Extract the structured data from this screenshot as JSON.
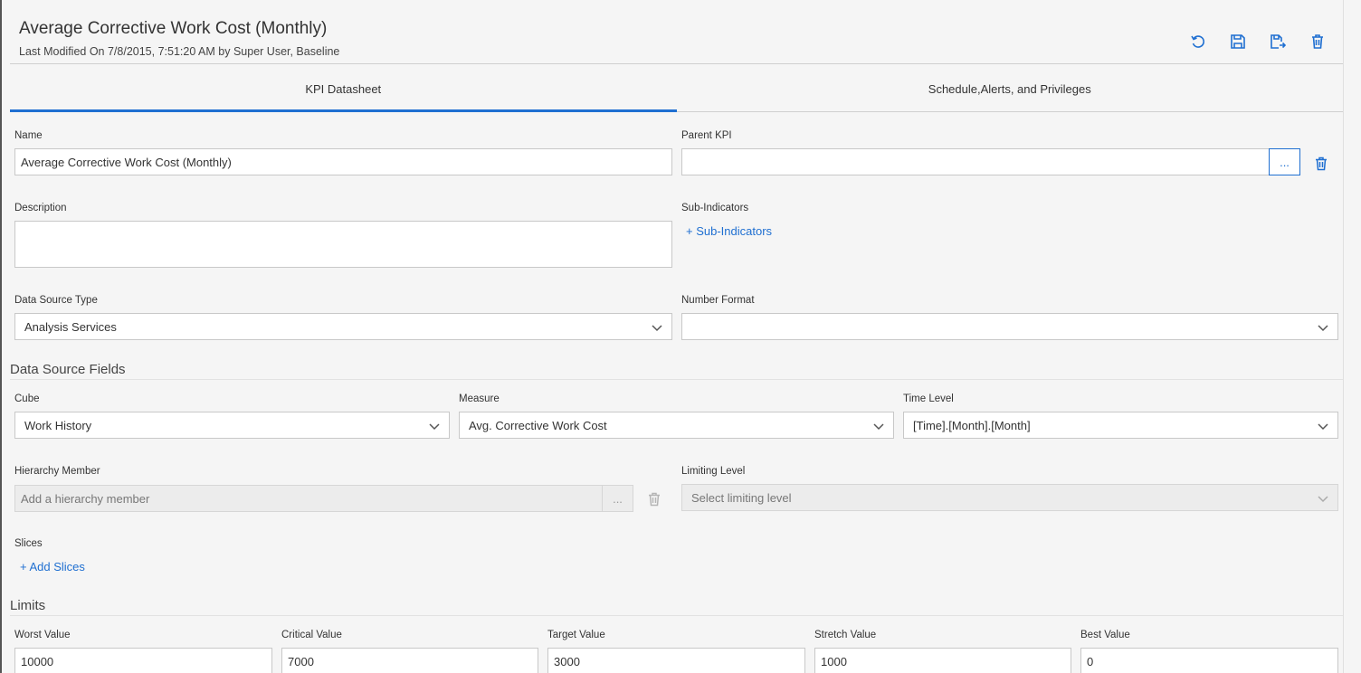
{
  "header": {
    "title": "Average Corrective Work Cost (Monthly)",
    "subtitle": "Last Modified On 7/8/2015, 7:51:20 AM by Super User, Baseline",
    "toolbar_icons": [
      "undo-icon",
      "save-icon",
      "save-as-icon",
      "delete-icon"
    ]
  },
  "tabs": [
    {
      "label": "KPI Datasheet",
      "active": true
    },
    {
      "label": "Schedule,Alerts, and Privileges",
      "active": false
    }
  ],
  "form": {
    "name": {
      "label": "Name",
      "value": "Average Corrective Work Cost (Monthly)"
    },
    "parent_kpi": {
      "label": "Parent KPI",
      "value": "",
      "browse": "..."
    },
    "description": {
      "label": "Description",
      "value": ""
    },
    "sub_indicators": {
      "label": "Sub-Indicators",
      "add_link": "+ Sub-Indicators"
    },
    "data_source_type": {
      "label": "Data Source Type",
      "value": "Analysis Services"
    },
    "number_format": {
      "label": "Number Format",
      "value": ""
    }
  },
  "data_source_fields": {
    "title": "Data Source Fields",
    "cube": {
      "label": "Cube",
      "value": "Work History"
    },
    "measure": {
      "label": "Measure",
      "value": "Avg. Corrective Work Cost"
    },
    "time_level": {
      "label": "Time Level",
      "value": "[Time].[Month].[Month]"
    },
    "hierarchy_member": {
      "label": "Hierarchy Member",
      "placeholder": "Add a hierarchy member",
      "browse": "..."
    },
    "limiting_level": {
      "label": "Limiting Level",
      "placeholder": "Select limiting level"
    },
    "slices": {
      "label": "Slices",
      "add_link": "+ Add Slices"
    }
  },
  "limits": {
    "title": "Limits",
    "worst": {
      "label": "Worst Value",
      "value": "10000"
    },
    "critical": {
      "label": "Critical Value",
      "value": "7000"
    },
    "target": {
      "label": "Target Value",
      "value": "3000"
    },
    "stretch": {
      "label": "Stretch Value",
      "value": "1000"
    },
    "best": {
      "label": "Best Value",
      "value": "0"
    }
  },
  "colors": {
    "accent": "#1f6fd1",
    "background": "#f5f5f5"
  }
}
